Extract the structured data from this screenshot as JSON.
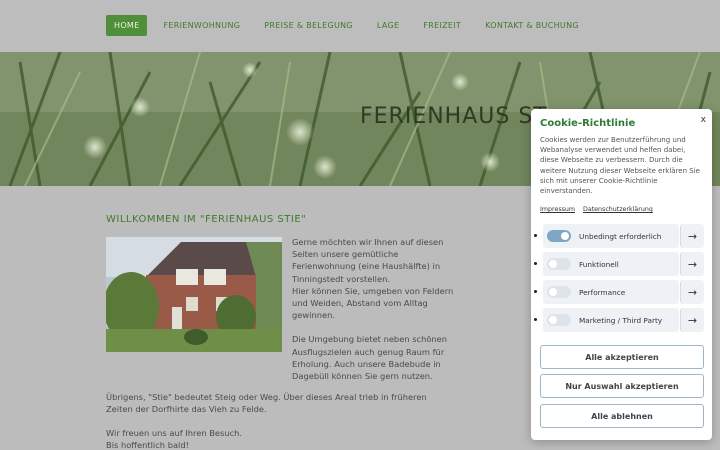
{
  "nav": {
    "items": [
      {
        "label": "Home",
        "active": true
      },
      {
        "label": "Ferienwohnung",
        "active": false
      },
      {
        "label": "Preise & Belegung",
        "active": false
      },
      {
        "label": "Lage",
        "active": false
      },
      {
        "label": "Freizeit",
        "active": false
      },
      {
        "label": "Kontakt & Buchung",
        "active": false
      }
    ]
  },
  "hero": {
    "title": "Ferienhaus St"
  },
  "main": {
    "welcome_heading": "Willkommen im \"Ferienhaus Stie\"",
    "para1": "Gerne möchten wir Ihnen auf diesen Seiten unsere gemütliche Ferienwohnung (eine Haushälfte) in Tinningstedt vorstellen.",
    "para2": "Hier können Sie, umgeben von Feldern und Weiden, Abstand vom Alltag gewinnen.",
    "para3": "Die Umgebung bietet neben schönen Ausflugszielen auch genug Raum für Erholung. Auch unsere Badebude in Dagebüll können Sie gern nutzen.",
    "para4": "Übrigens, \"Stie\" bedeutet Steig oder Weg. Über dieses Areal trieb in früheren Zeiten der Dorfhirte das Vieh zu Felde.",
    "para5_line1": "Wir freuen uns auf Ihren Besuch.",
    "para5_line2": "Bis hoffentlich bald!"
  },
  "cookie": {
    "close": "x",
    "title": "Cookie-Richtlinie",
    "text": "Cookies werden zur Benutzerführung und Webanalyse verwendet und helfen dabei, diese Webseite zu verbessern. Durch die weitere Nutzung dieser Webseite erklären Sie sich mit unserer Cookie-Richtlinie einverstanden.",
    "link_impressum": "Impressum",
    "link_datenschutz": "Datenschutzerklärung",
    "options": [
      {
        "label": "Unbedingt erforderlich",
        "on": true
      },
      {
        "label": "Funktionell",
        "on": false
      },
      {
        "label": "Performance",
        "on": false
      },
      {
        "label": "Marketing / Third Party",
        "on": false
      }
    ],
    "btn_accept_all": "Alle akzeptieren",
    "btn_accept_selection": "Nur Auswahl akzeptieren",
    "btn_reject_all": "Alle ablehnen",
    "arrow": "→"
  },
  "colors": {
    "accent": "#4f8f3a",
    "cookie_title": "#2e7a36",
    "toggle_on": "#7fa7c4"
  }
}
